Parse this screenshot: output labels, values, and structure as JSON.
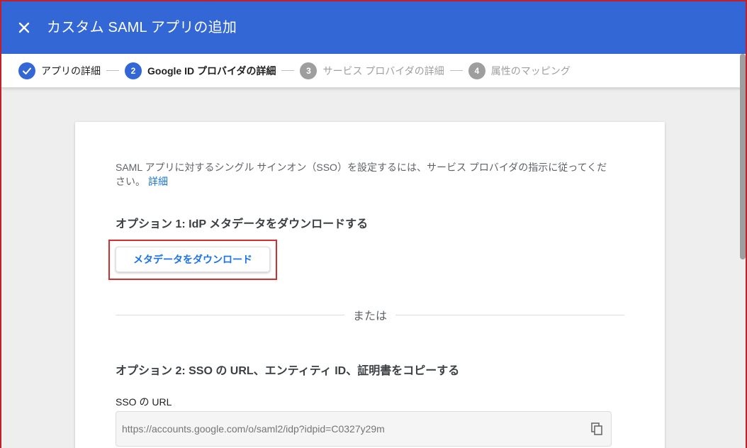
{
  "header": {
    "title": "カスタム SAML アプリの追加",
    "close_icon": "close-icon"
  },
  "stepper": {
    "steps": [
      {
        "number": "",
        "label": "アプリの詳細",
        "state": "done"
      },
      {
        "number": "2",
        "label": "Google ID プロバイダの詳細",
        "state": "current"
      },
      {
        "number": "3",
        "label": "サービス プロバイダの詳細",
        "state": "pending"
      },
      {
        "number": "4",
        "label": "属性のマッピング",
        "state": "pending"
      }
    ]
  },
  "content": {
    "intro_text": "SAML アプリに対するシングル サインオン（SSO）を設定するには、サービス プロバイダの指示に従ってください。",
    "learn_more_link": "詳細",
    "option1_title": "オプション 1: IdP メタデータをダウンロードする",
    "download_button": "メタデータをダウンロード",
    "or_text": "または",
    "option2_title": "オプション 2: SSO の URL、エンティティ ID、証明書をコピーする",
    "sso_url_label": "SSO の URL",
    "sso_url_value": "https://accounts.google.com/o/saml2/idp?idpid=C0327y29m"
  },
  "colors": {
    "header_blue": "#3367d6",
    "link_blue": "#1a73e8",
    "highlight_red": "#d32f2f"
  }
}
